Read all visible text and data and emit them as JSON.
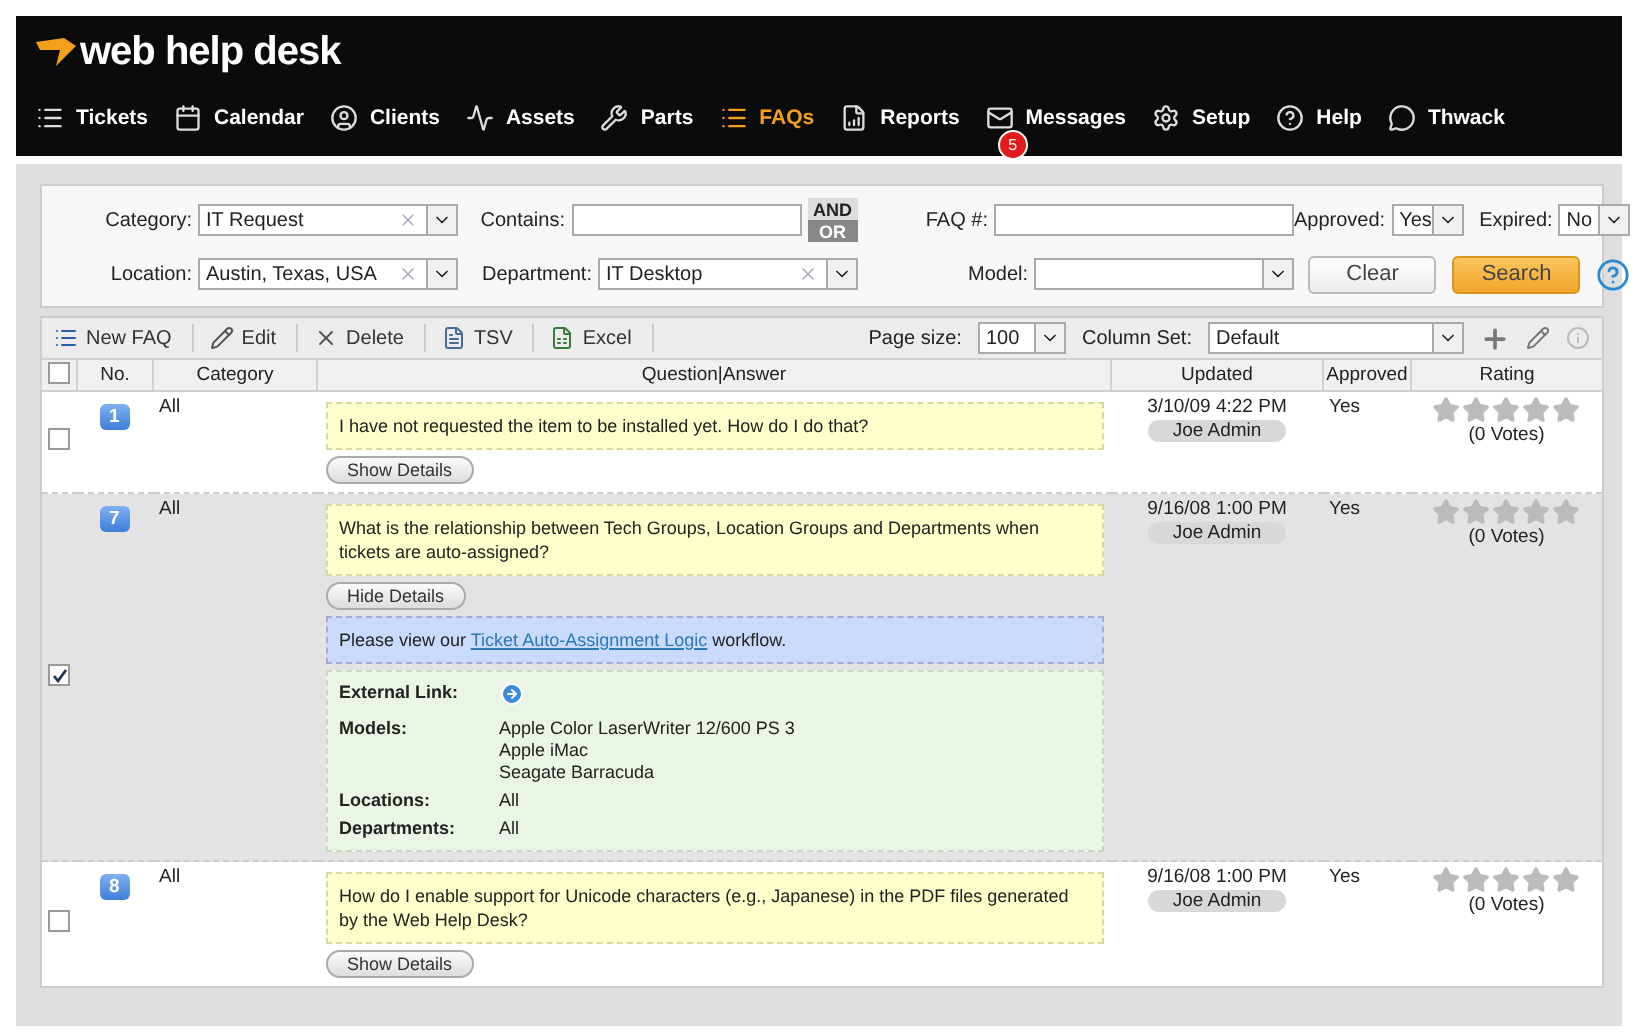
{
  "logo": {
    "text": "web help desk"
  },
  "nav": [
    {
      "label": "Tickets",
      "selected": false
    },
    {
      "label": "Calendar",
      "selected": false
    },
    {
      "label": "Clients",
      "selected": false
    },
    {
      "label": "Assets",
      "selected": false
    },
    {
      "label": "Parts",
      "selected": false
    },
    {
      "label": "FAQs",
      "selected": true
    },
    {
      "label": "Reports",
      "selected": false
    },
    {
      "label": "Messages",
      "selected": false,
      "badge": "5"
    },
    {
      "label": "Setup",
      "selected": false
    },
    {
      "label": "Help",
      "selected": false
    },
    {
      "label": "Thwack",
      "selected": false
    }
  ],
  "filters": {
    "row_1": [
      {
        "kind": "combo",
        "label": "Category:",
        "value": "IT Request"
      },
      {
        "kind": "text",
        "label": "Contains:",
        "and_label": "AND",
        "or_label": "OR"
      },
      {
        "kind": "text",
        "label": "FAQ #:"
      },
      {
        "kind": "select",
        "label": "Approved:",
        "value": "Yes"
      },
      {
        "kind": "select",
        "label": "Expired:",
        "value": "No"
      }
    ],
    "row_2": [
      {
        "kind": "combo",
        "label": "Location:",
        "value": "Austin, Texas, USA"
      },
      {
        "kind": "combo",
        "label": "Department:",
        "value": "IT Desktop"
      },
      {
        "kind": "select",
        "label": "Model:"
      }
    ],
    "clear_button": "Clear",
    "search_button": "Search"
  },
  "toolbar": {
    "buttons": [
      {
        "label": "New FAQ"
      },
      {
        "label": "Edit"
      },
      {
        "label": "Delete"
      },
      {
        "label": "TSV"
      },
      {
        "label": "Excel"
      }
    ],
    "page_size_label": "Page size:",
    "page_size": "100",
    "column_set_label": "Column Set:",
    "column_set": "Default"
  },
  "table": {
    "select_all_checked": false,
    "columns": [
      "No.",
      "Category",
      "Question|Answer",
      "Updated",
      "Approved",
      "Rating"
    ],
    "rows": [
      {
        "number": "1",
        "category": "All",
        "question": "I have not requested the item to be installed yet.  How do I do that?",
        "details_button": "Show Details",
        "expanded": false,
        "checked": false,
        "updated": "3/10/09 4:22 PM",
        "updated_by": "Joe Admin",
        "approved": "Yes",
        "stars": 0,
        "votes": "(0 Votes)"
      },
      {
        "number": "7",
        "category": "All",
        "question": "What is the relationship between Tech Groups, Location Groups and Departments when tickets are auto-assigned?",
        "details_button": "Hide Details",
        "expanded": true,
        "checked": true,
        "updated": "9/16/08 1:00 PM",
        "updated_by": "Joe Admin",
        "approved": "Yes",
        "stars": 0,
        "votes": "(0 Votes)",
        "answer": {
          "before": "Please view our",
          "link": "Ticket Auto-Assignment Logic",
          "after": "workflow."
        },
        "details": {
          "external_link_label": "External Link:",
          "models_label": "Models:",
          "models": [
            "Apple Color LaserWriter 12/600 PS 3",
            "Apple iMac",
            "Seagate Barracuda"
          ],
          "locations_label": "Locations:",
          "locations": "All",
          "departments_label": "Departments:",
          "departments": "All"
        }
      },
      {
        "number": "8",
        "category": "All",
        "question": "How do I enable support for Unicode characters (e.g., Japanese) in the PDF files generated by the Web Help Desk?",
        "details_button": "Show Details",
        "expanded": false,
        "checked": false,
        "updated": "9/16/08 1:00 PM",
        "updated_by": "Joe Admin",
        "approved": "Yes",
        "stars": 0,
        "votes": "(0 Votes)"
      }
    ]
  }
}
